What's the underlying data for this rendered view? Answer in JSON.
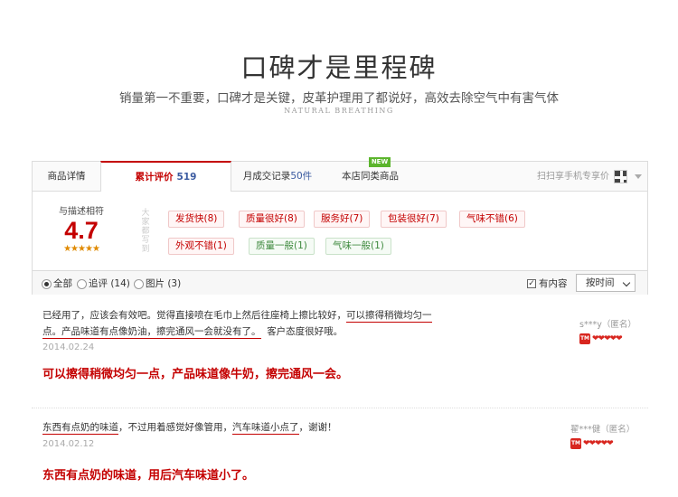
{
  "hero": {
    "title": "口碑才是里程碑",
    "subtitle": "销量第一不重要，口碑才是关键，皮革护理用了都说好，高效去除空气中有害气体",
    "english": "NATURAL BREATHING"
  },
  "tabs": {
    "details": "商品详情",
    "reviews_label": "累计评价",
    "reviews_count": "519",
    "sales_label": "月成交记录",
    "sales_count": "50件",
    "store": "本店同类商品",
    "new_badge": "NEW",
    "mobile": "扫扫享手机专享价"
  },
  "rating": {
    "label": "与描述相符",
    "score": "4.7",
    "stars": "★★★★★",
    "impressions_label": "大家都写到"
  },
  "tags": [
    {
      "text": "发货快(8)",
      "kind": "pos"
    },
    {
      "text": "质量很好(8)",
      "kind": "pos"
    },
    {
      "text": "服务好(7)",
      "kind": "pos"
    },
    {
      "text": "包装很好(7)",
      "kind": "pos"
    },
    {
      "text": "气味不错(6)",
      "kind": "pos"
    },
    {
      "text": "外观不错(1)",
      "kind": "pos"
    },
    {
      "text": "质量一般(1)",
      "kind": "neu"
    },
    {
      "text": "气味一般(1)",
      "kind": "neu"
    }
  ],
  "filters": {
    "all": "全部",
    "followup": "追评 (14)",
    "images": "图片 (3)",
    "has_content": "有内容",
    "check_mark": "✓",
    "sort": "按时间"
  },
  "reviews": [
    {
      "line1_a": "已经用了，应该会有效吧。觉得直接喷在毛巾上然后往座椅上擦比较好，",
      "line1_b": "可以擦得稍微均匀一",
      "line2_a": "点。产品味道有点像奶油，擦完通风一会就没有了。",
      "line2_b": "客户态度很好哦。",
      "date": "2014.02.24",
      "user": "s***y（匿名）",
      "summary": "可以擦得稍微均匀一点，产品味道像牛奶，擦完通风一会。"
    },
    {
      "line1_a": "东西有点奶的味道",
      "line1_b": "，不过用着感觉好像管用，",
      "line1_c": "汽车味道小点了",
      "line1_d": "，谢谢！",
      "date": "2014.02.12",
      "user": "翟***健（匿名）",
      "summary": "东西有点奶的味道，用后汽车味道小了。"
    }
  ],
  "badge": {
    "tm": "TM",
    "hearts": "❤❤❤❤❤"
  },
  "colors": {
    "accent": "#c40000",
    "link_blue": "#3a5aa0",
    "neutral_green": "#3f8a3f"
  }
}
